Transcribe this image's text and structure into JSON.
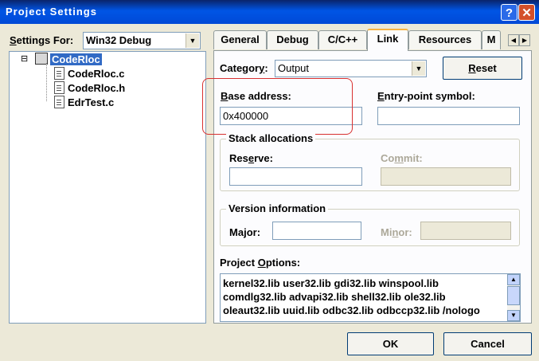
{
  "window": {
    "title": "Project Settings"
  },
  "titlebar": {
    "help": "?",
    "close": "✕"
  },
  "settings_for": {
    "label_pre": "",
    "label_ul": "S",
    "label_post": "ettings For:",
    "value": "Win32 Debug"
  },
  "tree": {
    "root": "CodeRloc",
    "expander": "⊟",
    "files": [
      "CodeRloc.c",
      "CodeRloc.h",
      "EdrTest.c"
    ]
  },
  "tabs": [
    "General",
    "Debug",
    "C/C++",
    "Link",
    "Resources",
    "M"
  ],
  "tab_scroll": {
    "left": "◀",
    "right": "▶"
  },
  "category": {
    "label": "Category:",
    "label_ul": "y",
    "value": "Output"
  },
  "reset_button": {
    "ul": "R",
    "rest": "eset"
  },
  "base_address": {
    "label_ul": "B",
    "label_rest": "ase address:",
    "value": "0x400000"
  },
  "entry_point": {
    "label_ul": "E",
    "label_rest": "ntry-point symbol:",
    "value": ""
  },
  "stack": {
    "title": "Stack allocations",
    "reserve_label_pre": "Res",
    "reserve_label_ul": "e",
    "reserve_label_post": "rve:",
    "reserve_value": "",
    "commit_label_pre": "Co",
    "commit_label_ul": "m",
    "commit_label_post": "mit:",
    "commit_value": ""
  },
  "version": {
    "title": "Version information",
    "major_label_pre": "Ma",
    "major_label_ul": "j",
    "major_label_post": "or:",
    "major_value": "",
    "minor_label_pre": "Mi",
    "minor_label_ul": "n",
    "minor_label_post": "or:",
    "minor_value": ""
  },
  "project_options": {
    "label_pre": "Project ",
    "label_ul": "O",
    "label_post": "ptions:",
    "lines": [
      "kernel32.lib user32.lib gdi32.lib winspool.lib",
      "comdlg32.lib advapi32.lib shell32.lib ole32.lib",
      "oleaut32.lib uuid.lib odbc32.lib odbccp32.lib /nologo"
    ]
  },
  "buttons": {
    "ok": "OK",
    "cancel": "Cancel"
  }
}
